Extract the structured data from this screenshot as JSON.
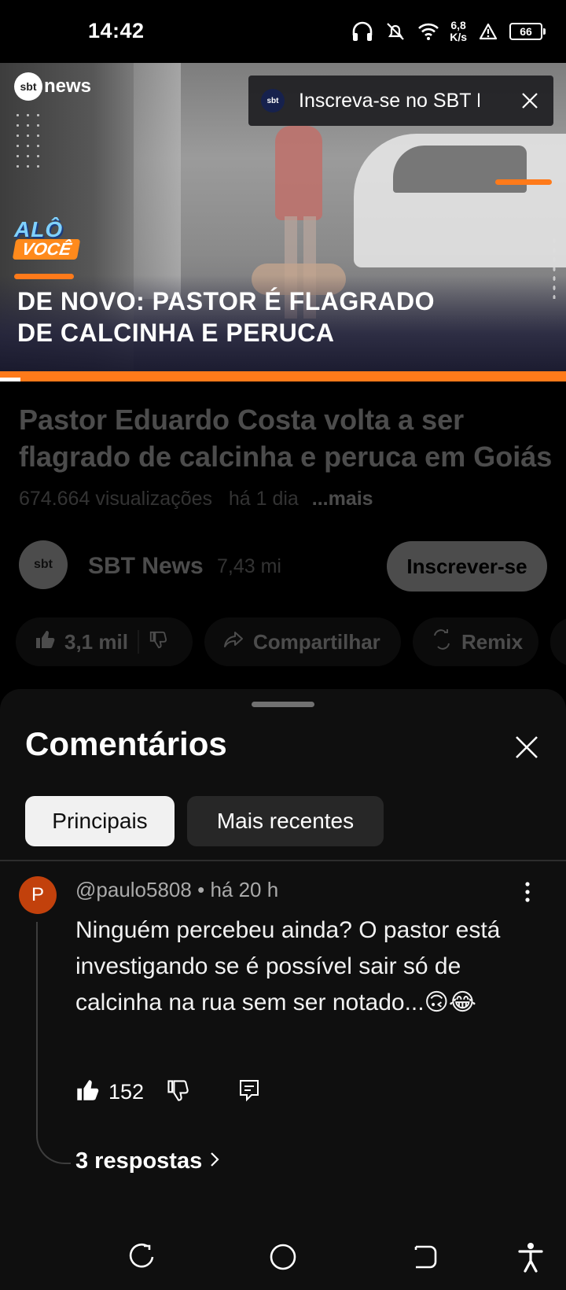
{
  "status_bar": {
    "time": "14:42",
    "speed_value": "6,8",
    "speed_unit": "K/s",
    "battery": "66",
    "icons": [
      "headphones-icon",
      "mute-icon",
      "wifi-icon",
      "speed-indicator",
      "alert-icon",
      "battery-icon"
    ]
  },
  "video": {
    "channel_logo_text": "news",
    "channel_logo_badge": "sbt",
    "show_logo_top": "ALÔ",
    "show_logo_bottom": "VOCÊ",
    "headline_line1": "DE NOVO: PASTOR É FLAGRADO",
    "headline_line2": "DE CALCINHA E PERUCA",
    "subscribe_toast": "Inscreva-se no SBT News",
    "toast_logo_badge": "sbt",
    "accent_color": "#ff7a1a"
  },
  "details": {
    "title": "Pastor Eduardo Costa volta a ser flagrado de calcinha e peruca em Goiás",
    "title_line1": "Pastor Eduardo Costa volta a ser",
    "title_line2": "flagrado de calcinha e peruca em Goiás",
    "views": "674.664 visualizações",
    "age": "há 1 dia",
    "more": "...mais",
    "channel_avatar_badge": "sbt",
    "channel_name": "SBT News",
    "subscribers": "7,43 mi",
    "subscribe_label": "Inscrever-se",
    "like_count": "3,1 mil",
    "share_label": "Compartilhar",
    "remix_label": "Remix"
  },
  "comments_sheet": {
    "title": "Comentários",
    "chips": [
      {
        "label": "Principais",
        "active": true
      },
      {
        "label": "Mais recentes",
        "active": false
      }
    ],
    "comment": {
      "avatar_letter": "P",
      "avatar_color": "#c2410c",
      "author": "@paulo5808",
      "separator": "•",
      "age": "há 20 h",
      "text": "Ninguém percebeu ainda? O pastor está investigando se é possível sair só de calcinha na rua sem ser notado...🙃😂",
      "likes": "152",
      "replies_label": "3 respostas"
    }
  },
  "nav_bar": {
    "buttons": [
      "recents-icon",
      "home-icon",
      "back-icon",
      "accessibility-icon"
    ]
  }
}
